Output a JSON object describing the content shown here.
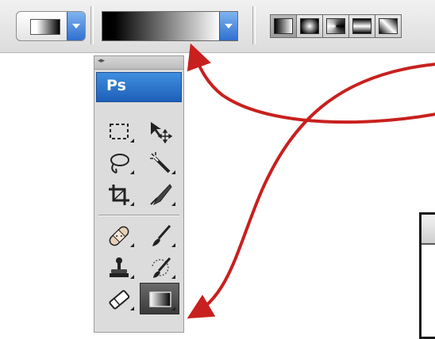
{
  "options_bar": {
    "tool_preset_icon": "gradient-tool-preset-icon",
    "gradient_picker_icon": "gradient-editor-swatch",
    "gradient_types": [
      {
        "name": "linear",
        "icon": "linear-gradient-icon"
      },
      {
        "name": "radial",
        "icon": "radial-gradient-icon"
      },
      {
        "name": "angle",
        "icon": "angle-gradient-icon"
      },
      {
        "name": "reflected",
        "icon": "reflected-gradient-icon"
      },
      {
        "name": "diamond",
        "icon": "diamond-gradient-icon"
      }
    ],
    "active_gradient_type": "linear"
  },
  "tools_panel": {
    "logo_text": "Ps",
    "grip_icon": "collapse-arrows-icon",
    "tools": [
      {
        "icon": "rectangular-marquee-icon"
      },
      {
        "icon": "move-icon"
      },
      {
        "icon": "lasso-icon"
      },
      {
        "icon": "magic-wand-icon"
      },
      {
        "icon": "crop-icon"
      },
      {
        "icon": "slice-icon"
      },
      {
        "icon": "spot-healing-brush-icon"
      },
      {
        "icon": "brush-icon"
      },
      {
        "icon": "clone-stamp-icon"
      },
      {
        "icon": "history-brush-icon"
      },
      {
        "icon": "eraser-icon"
      },
      {
        "icon": "gradient-icon",
        "selected": true
      }
    ]
  },
  "annotations": {
    "arrow_color": "#c8201e",
    "arrows": [
      "to-gradient-picker",
      "to-gradient-tool"
    ]
  }
}
